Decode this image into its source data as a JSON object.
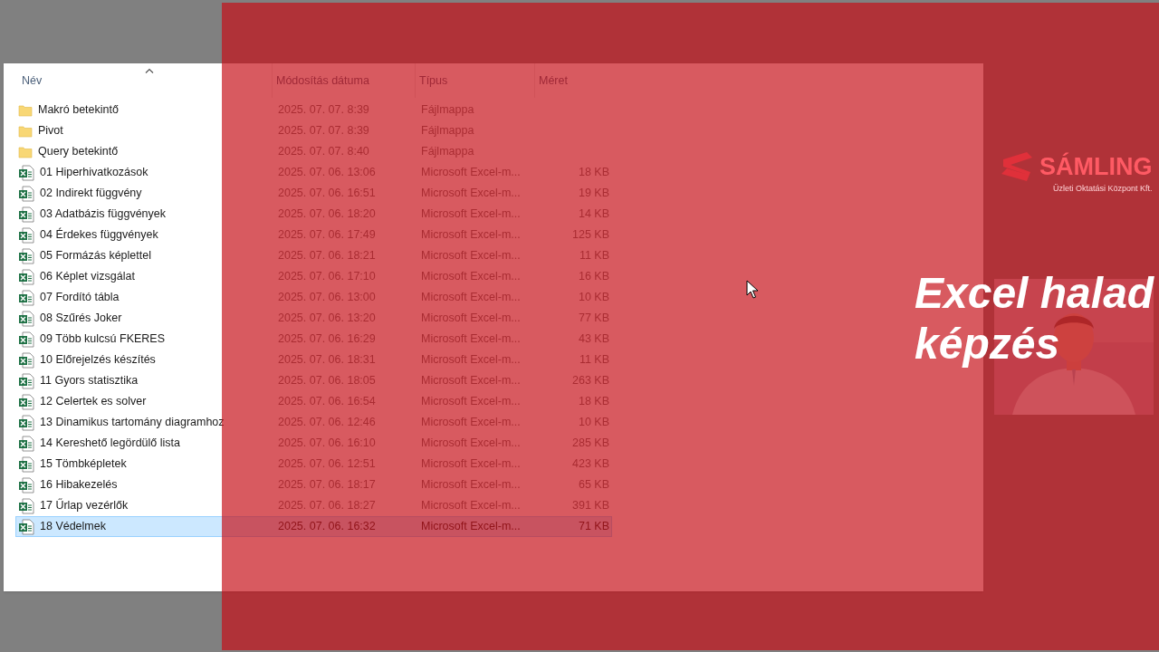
{
  "columns": [
    {
      "label": "Név",
      "sorted": true
    },
    {
      "label": "Módosítás dátuma",
      "sorted": false
    },
    {
      "label": "Típus",
      "sorted": false
    },
    {
      "label": "Méret",
      "sorted": false
    }
  ],
  "rows": [
    {
      "kind": "folder",
      "name": "Makró betekintő",
      "modified": "2025. 07. 07. 8:39",
      "type": "Fájlmappa",
      "selected": false
    },
    {
      "kind": "folder",
      "name": "Pivot",
      "modified": "2025. 07. 07. 8:39",
      "type": "Fájlmappa",
      "selected": false
    },
    {
      "kind": "folder",
      "name": "Query betekintő",
      "modified": "2025. 07. 07. 8:40",
      "type": "Fájlmappa",
      "selected": false
    },
    {
      "kind": "excel",
      "name": "01 Hiperhivatkozások",
      "modified": "2025. 07. 06. 13:06",
      "type": "Microsoft Excel-m...",
      "size": "18 KB",
      "selected": false
    },
    {
      "kind": "excel",
      "name": "02 Indirekt függvény",
      "modified": "2025. 07. 06. 16:51",
      "type": "Microsoft Excel-m...",
      "size": "19 KB",
      "selected": false
    },
    {
      "kind": "excel",
      "name": "03 Adatbázis függvények",
      "modified": "2025. 07. 06. 18:20",
      "type": "Microsoft Excel-m...",
      "size": "14 KB",
      "selected": false
    },
    {
      "kind": "excel",
      "name": "04 Érdekes függvények",
      "modified": "2025. 07. 06. 17:49",
      "type": "Microsoft Excel-m...",
      "size": "125 KB",
      "selected": false
    },
    {
      "kind": "excel",
      "name": "05 Formázás képlettel",
      "modified": "2025. 07. 06. 18:21",
      "type": "Microsoft Excel-m...",
      "size": "11 KB",
      "selected": false
    },
    {
      "kind": "excel",
      "name": "06 Képlet vizsgálat",
      "modified": "2025. 07. 06. 17:10",
      "type": "Microsoft Excel-m...",
      "size": "16 KB",
      "selected": false
    },
    {
      "kind": "excel",
      "name": "07 Fordító tábla",
      "modified": "2025. 07. 06. 13:00",
      "type": "Microsoft Excel-m...",
      "size": "10 KB",
      "selected": false
    },
    {
      "kind": "excel",
      "name": "08 Szűrés Joker",
      "modified": "2025. 07. 06. 13:20",
      "type": "Microsoft Excel-m...",
      "size": "77 KB",
      "selected": false
    },
    {
      "kind": "excel",
      "name": "09 Több kulcsú FKERES",
      "modified": "2025. 07. 06. 16:29",
      "type": "Microsoft Excel-m...",
      "size": "43 KB",
      "selected": false
    },
    {
      "kind": "excel",
      "name": "10 Előrejelzés készítés",
      "modified": "2025. 07. 06. 18:31",
      "type": "Microsoft Excel-m...",
      "size": "11 KB",
      "selected": false
    },
    {
      "kind": "excel",
      "name": "11 Gyors statisztika",
      "modified": "2025. 07. 06. 18:05",
      "type": "Microsoft Excel-m...",
      "size": "263 KB",
      "selected": false
    },
    {
      "kind": "excel",
      "name": "12 Celertek es solver",
      "modified": "2025. 07. 06. 16:54",
      "type": "Microsoft Excel-m...",
      "size": "18 KB",
      "selected": false
    },
    {
      "kind": "excel",
      "name": "13 Dinamikus tartomány diagramhoz",
      "modified": "2025. 07. 06. 12:46",
      "type": "Microsoft Excel-m...",
      "size": "10 KB",
      "selected": false
    },
    {
      "kind": "excel",
      "name": "14 Kereshető legördülő lista",
      "modified": "2025. 07. 06. 16:10",
      "type": "Microsoft Excel-m...",
      "size": "285 KB",
      "selected": false
    },
    {
      "kind": "excel",
      "name": "15 Tömbképletek",
      "modified": "2025. 07. 06. 12:51",
      "type": "Microsoft Excel-m...",
      "size": "423 KB",
      "selected": false
    },
    {
      "kind": "excel",
      "name": "16 Hibakezelés",
      "modified": "2025. 07. 06. 18:17",
      "type": "Microsoft Excel-m...",
      "size": "65 KB",
      "selected": false
    },
    {
      "kind": "excel",
      "name": "17 Űrlap vezérlők",
      "modified": "2025. 07. 06. 18:27",
      "type": "Microsoft Excel-m...",
      "size": "391 KB",
      "selected": false
    },
    {
      "kind": "excel",
      "name": "18 Védelmek",
      "modified": "2025. 07. 06. 16:32",
      "type": "Microsoft Excel-m...",
      "size": "71 KB",
      "selected": true
    }
  ],
  "logo": {
    "name": "SÁMLING",
    "tagline": "Üzleti Oktatási Központ Kft."
  },
  "title": [
    "Excel halad",
    "képzés"
  ]
}
